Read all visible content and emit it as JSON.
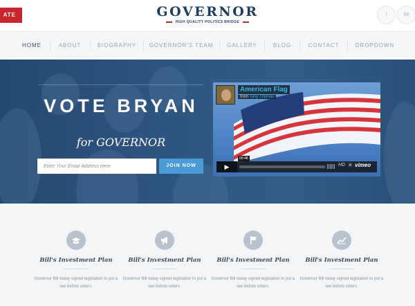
{
  "header": {
    "donate_label": "ATE",
    "logo_title": "GOVERNOR",
    "logo_subtitle": "HIGH QUALITY POLITICS BRIDGE",
    "social": [
      {
        "icon": "facebook-icon",
        "label": "f"
      },
      {
        "icon": "behance-icon",
        "label": "Bē"
      }
    ]
  },
  "nav": {
    "items": [
      {
        "label": "HOME",
        "active": true
      },
      {
        "label": "ABOUT",
        "active": false
      },
      {
        "label": "BIOGRAPHY",
        "active": false
      },
      {
        "label": "GOVERNOR'S TEAM",
        "active": false
      },
      {
        "label": "GALLERY",
        "active": false
      },
      {
        "label": "BLOG",
        "active": false
      },
      {
        "label": "CONTACT",
        "active": false
      },
      {
        "label": "DROPDOWN",
        "active": false
      }
    ]
  },
  "hero": {
    "title": "VOTE BRYAN",
    "subtitle": "for GOVERNOR",
    "email_placeholder": "Enter Your Email Address Here",
    "join_label": "JOIN NOW",
    "video": {
      "title": "American Flag",
      "byline_prefix": "from",
      "byline_name": "Tony Thomas",
      "time": "00:48",
      "hd_label": "HD",
      "brand": "vimeo"
    }
  },
  "features": [
    {
      "icon": "graduation-cap-icon",
      "title": "Bill's Investment Plan",
      "text": "Governor Bill today signed legislation to put a law before voters."
    },
    {
      "icon": "megaphone-icon",
      "title": "Bill's Investment Plan",
      "text": "Governor Bill today signed legislation to put a law before voters."
    },
    {
      "icon": "flag-icon",
      "title": "Bill's Investment Plan",
      "text": "Governor Bill today signed legislation to put a law before voters."
    },
    {
      "icon": "chart-line-icon",
      "title": "Bill's Investment Plan",
      "text": "Governor Bill today signed legislation to put a law before voters."
    }
  ],
  "colors": {
    "brand_navy": "#1e3c5f",
    "donate_red": "#c8262c",
    "join_blue": "#4a9bd8",
    "hero_blue": "#2e5580"
  }
}
